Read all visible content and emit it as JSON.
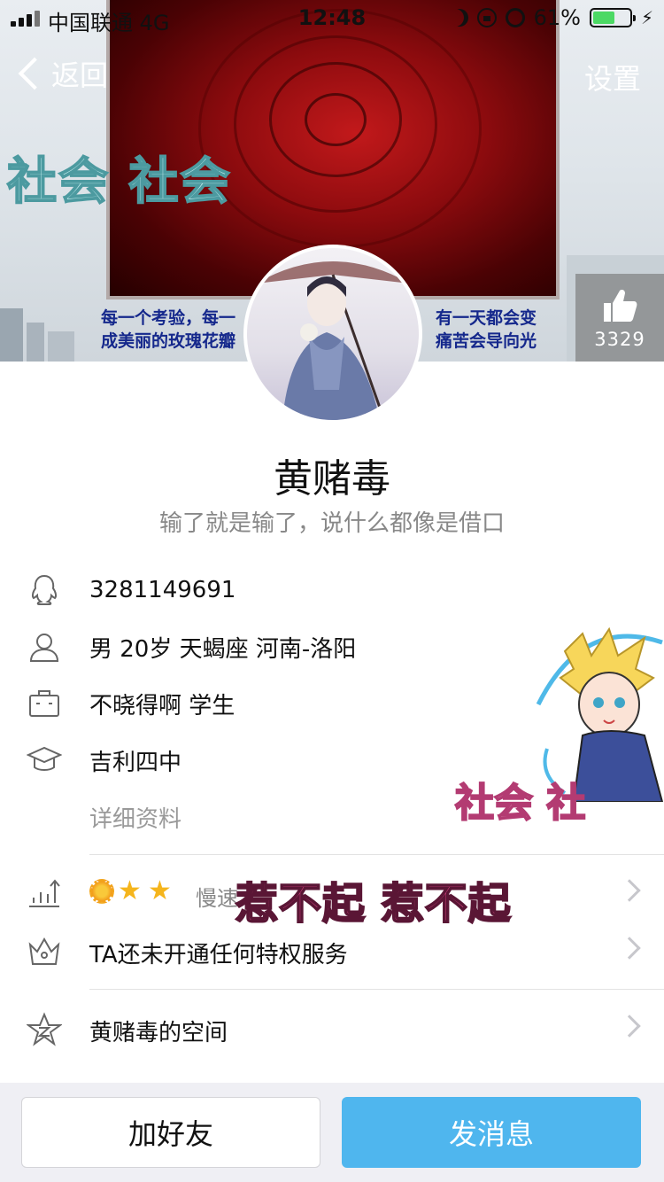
{
  "status_bar": {
    "carrier": "中国联通  4G",
    "time": "12:48",
    "battery_percent": "61%",
    "battery_level": 0.61,
    "battery_color": "#4cd964"
  },
  "nav": {
    "back_label": "返回",
    "settings_label": "设置"
  },
  "cover": {
    "overlay_text": "社会 社会",
    "quote_left": [
      "每一个考验，每一",
      "成美丽的玫瑰花瓣"
    ],
    "quote_right": [
      "有一天都会变",
      "痛苦会导向光"
    ]
  },
  "likes": {
    "icon": "thumbs-up-icon",
    "count": "3329"
  },
  "profile": {
    "nickname": "黄赌毒",
    "signature": "输了就是输了，说什么都像是借口"
  },
  "info": {
    "qq": {
      "icon": "qq-penguin-icon",
      "value": "3281149691"
    },
    "basic": {
      "icon": "person-icon",
      "value": "男 20岁 天蝎座 河南-洛阳"
    },
    "job": {
      "icon": "briefcase-icon",
      "value": "不晓得啊 学生"
    },
    "school": {
      "icon": "graduation-cap-icon",
      "value": "吉利四中"
    },
    "detail_link": "详细资料"
  },
  "menu": {
    "level": {
      "icon": "level-chart-icon",
      "badges": [
        "sun",
        "star",
        "star"
      ],
      "speed_text": "慢速"
    },
    "privilege": {
      "icon": "crown-icon",
      "label": "TA还未开通任何特权服务"
    },
    "space": {
      "icon": "qzone-star-icon",
      "label": "黄赌毒的空间"
    }
  },
  "stickers": {
    "social": "社会 社",
    "provoke": "惹不起 惹不起"
  },
  "actions": {
    "add_friend": "加好友",
    "send_message": "发消息",
    "accent_color": "#4fb6ee"
  }
}
